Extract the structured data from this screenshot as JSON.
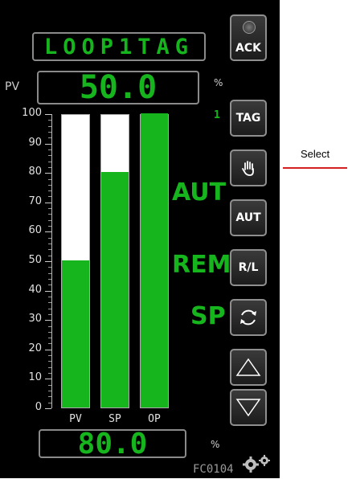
{
  "title": "LOOP1TAG",
  "pv": {
    "label": "PV",
    "value": "50.0",
    "unit": "%"
  },
  "output": {
    "value": "80.0",
    "unit": "%"
  },
  "scale_ticks": [
    "100",
    "90",
    "80",
    "70",
    "60",
    "50",
    "40",
    "30",
    "20",
    "10",
    "0"
  ],
  "bars": [
    {
      "label": "PV",
      "percent": 50
    },
    {
      "label": "SP",
      "percent": 80
    },
    {
      "label": "OP",
      "percent": 100
    }
  ],
  "modes": {
    "auto": "AUT",
    "remote": "REM",
    "setpoint": "SP"
  },
  "buttons": {
    "ack": "ACK",
    "tag": "TAG",
    "aut": "AUT",
    "rl": "R/L"
  },
  "tag_number": "1",
  "device_id": "FC0104",
  "annotation": {
    "label": "Select",
    "color": "#d42020"
  },
  "colors": {
    "bar_fill": "#16b51e",
    "panel": "#000000"
  }
}
